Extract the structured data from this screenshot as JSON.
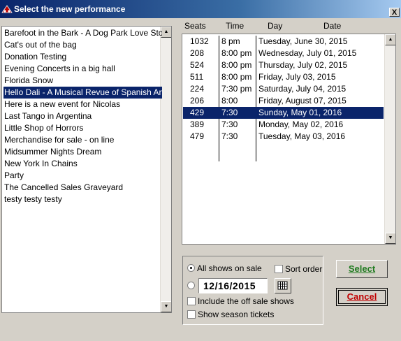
{
  "window": {
    "title": "Select the new performance",
    "close_label": "X"
  },
  "events": [
    "Barefoot in the Bark - A Dog Park Love Story",
    "Cat's out of the bag",
    "Donation Testing",
    "Evening Concerts in a big hall",
    "Florida Snow",
    "Hello Dali - A Musical Revue of Spanish Art",
    "Here is a new event for Nicolas",
    "Last Tango in Argentina",
    "Little Shop of Horrors",
    "Merchandise for sale - on line",
    "Midsummer Nights Dream",
    "New York In Chains",
    "Party",
    "The Cancelled Sales Graveyard",
    "testy testy testy"
  ],
  "selected_event_index": 5,
  "performances": {
    "columns": [
      "Seats",
      "Time",
      "Day",
      "Date"
    ],
    "rows": [
      {
        "seats": "1032",
        "time": "8 pm",
        "date": "Tuesday, June 30, 2015"
      },
      {
        "seats": "208",
        "time": "8:00 pm",
        "date": "Wednesday, July 01, 2015"
      },
      {
        "seats": "524",
        "time": "8:00 pm",
        "date": "Thursday, July 02, 2015"
      },
      {
        "seats": "511",
        "time": "8:00 pm",
        "date": "Friday, July 03, 2015"
      },
      {
        "seats": "224",
        "time": "7:30 pm",
        "date": "Saturday, July 04, 2015"
      },
      {
        "seats": "206",
        "time": "8:00",
        "date": "Friday, August 07, 2015"
      },
      {
        "seats": "429",
        "time": "7:30",
        "date": "Sunday, May 01, 2016"
      },
      {
        "seats": "389",
        "time": "7:30",
        "date": "Monday, May 02, 2016"
      },
      {
        "seats": "479",
        "time": "7:30",
        "date": "Tuesday, May 03, 2016"
      }
    ],
    "selected_row_index": 6
  },
  "options": {
    "all_shows_label": "All shows on sale",
    "all_shows_selected": true,
    "sort_order_label": "Sort order",
    "date_value": "12/16/2015",
    "include_off_sale_label": "Include the off sale shows",
    "show_season_label": "Show season tickets"
  },
  "buttons": {
    "select_label": "Select",
    "cancel_label": "Cancel"
  },
  "colors": {
    "selection": "#0a246a",
    "select_text": "#1f7a1f",
    "cancel_text": "#c00000"
  }
}
